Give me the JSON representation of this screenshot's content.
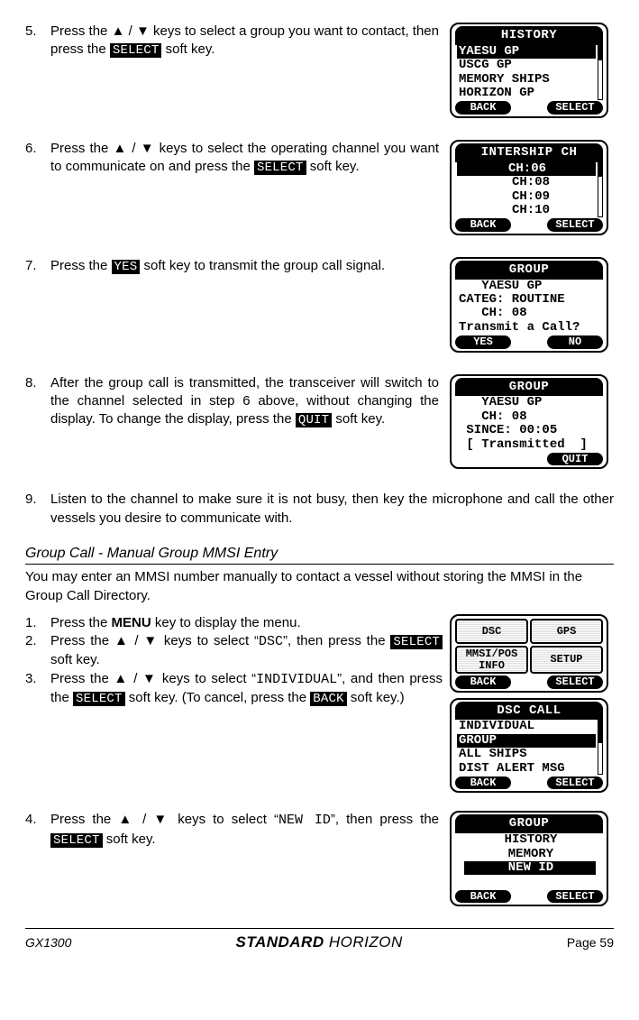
{
  "steps_a": [
    {
      "num": "5.",
      "text_pre": "Press the ",
      "arrows": "▲ / ▼",
      "text_mid": " keys to select a group you want to contact, then press the ",
      "key": "SELECT",
      "text_post": " soft key."
    },
    {
      "num": "6.",
      "text_pre": "Press the ",
      "arrows": "▲ / ▼",
      "text_mid": " keys to select the operating channel you want to communicate on and press the ",
      "key": "SELECT",
      "text_post": " soft key."
    },
    {
      "num": "7.",
      "text_pre": "Press the ",
      "key": "YES",
      "text_post": " soft key to transmit the group call signal."
    },
    {
      "num": "8.",
      "text_pre": "After the group call is transmitted, the transceiver will switch to the channel selected in step 6 above, without changing the display. To change the display, press the ",
      "key": "QUIT",
      "text_post": " soft key."
    },
    {
      "num": "9.",
      "text_full": "Listen to the channel to make sure it is not busy, then key the microphone and call the other vessels you desire to communicate with."
    }
  ],
  "lcd": {
    "history": {
      "title": "HISTORY",
      "lines": [
        "YAESU GP",
        "USCG GP",
        "MEMORY SHIPS",
        "HORIZON GP"
      ],
      "sel_index": 0,
      "back": "BACK",
      "select": "SELECT"
    },
    "intership": {
      "title": "INTERSHIP CH",
      "lines": [
        "CH:06",
        "CH:08",
        "CH:09",
        "CH:10"
      ],
      "sel_index": 0,
      "back": "BACK",
      "select": "SELECT"
    },
    "group_confirm": {
      "title": "GROUP",
      "lines": [
        "   YAESU GP",
        "CATEG: ROUTINE",
        "   CH: 08",
        "Transmit a Call?"
      ],
      "yes": "YES",
      "no": "NO"
    },
    "group_transmitted": {
      "title": "GROUP",
      "lines": [
        "   YAESU GP",
        "   CH: 08",
        " SINCE: 00:05",
        " [ Transmitted  ]"
      ],
      "quit": "QUIT"
    },
    "menu_quad": {
      "q1": "DSC",
      "q2": "GPS",
      "q3a": "MMSI/POS",
      "q3b": "INFO",
      "q4": "SETUP",
      "back": "BACK",
      "select": "SELECT"
    },
    "dsc_call": {
      "title": "DSC CALL",
      "lines": [
        "INDIVIDUAL",
        "GROUP",
        "ALL SHIPS",
        "DIST ALERT MSG"
      ],
      "sel_index": 1,
      "back": "BACK",
      "select": "SELECT"
    },
    "group_menu": {
      "title": "GROUP",
      "lines": [
        "HISTORY",
        "MEMORY",
        "NEW ID"
      ],
      "sel_index": 2,
      "back": "BACK",
      "select": "SELECT"
    }
  },
  "section_b": {
    "heading": "Group Call - Manual Group MMSI Entry",
    "intro": "You may enter an MMSI number manually to contact a vessel without storing the MMSI in the Group Call Directory."
  },
  "steps_b": {
    "s1": {
      "num": "1.",
      "pre": "Press the ",
      "menu": "MENU",
      "post": " key to display the menu."
    },
    "s2": {
      "num": "2.",
      "pre": "Press the ",
      "arrows": "▲ / ▼",
      "mid": " keys to select “",
      "code": "DSC",
      "mid2": "”, then press the ",
      "key": "SELECT",
      "post": " soft key."
    },
    "s3": {
      "num": "3.",
      "pre": "Press the ",
      "arrows": "▲ / ▼",
      "mid": " keys to select “",
      "code": "INDIVIDU­AL",
      "mid2": "”, and then press the ",
      "key": "SELECT",
      "post": " soft key. (To cancel, press the ",
      "key2": "BACK",
      "post2": " soft key.)"
    },
    "s4": {
      "num": "4.",
      "pre": "Press the ",
      "arrows": "▲ / ▼",
      "mid": " keys to select “",
      "code": "NEW ID",
      "mid2": "”, then press the ",
      "key": "SELECT",
      "post": " soft key."
    }
  },
  "footer": {
    "model": "GX1300",
    "brand_bold": "STANDARD",
    "brand_light": " HORIZON",
    "page": "Page 59"
  }
}
